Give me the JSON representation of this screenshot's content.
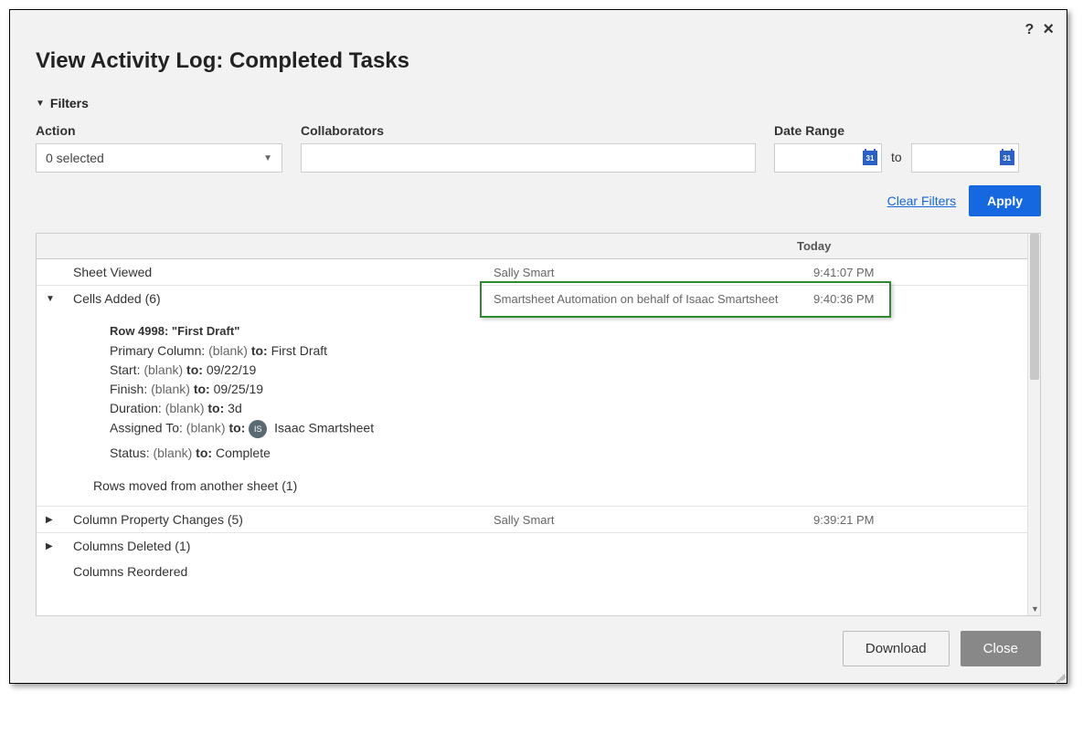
{
  "header": {
    "title": "View Activity Log: Completed Tasks"
  },
  "filters": {
    "section_label": "Filters",
    "action_label": "Action",
    "action_selected": "0 selected",
    "collaborators_label": "Collaborators",
    "date_range_label": "Date Range",
    "to_label": "to",
    "clear_filters": "Clear Filters",
    "apply": "Apply"
  },
  "log": {
    "date_header": "Today",
    "rows": [
      {
        "expanded": null,
        "event": "Sheet Viewed",
        "collab": "Sally Smart",
        "time": "9:41:07 PM"
      },
      {
        "expanded": true,
        "event": "Cells Added (6)",
        "collab": "Smartsheet Automation on behalf of Isaac Smartsheet",
        "time": "9:40:36 PM"
      }
    ],
    "details": {
      "row_title": "Row 4998: \"First Draft\"",
      "changes": [
        {
          "field": "Primary Column:",
          "from": "(blank)",
          "to": "First Draft"
        },
        {
          "field": "Start:",
          "from": "(blank)",
          "to": "09/22/19"
        },
        {
          "field": "Finish:",
          "from": "(blank)",
          "to": "09/25/19"
        },
        {
          "field": "Duration:",
          "from": "(blank)",
          "to": "3d"
        },
        {
          "field": "Assigned To:",
          "from": "(blank)",
          "to_avatar": "IS",
          "to": "Isaac Smartsheet"
        },
        {
          "field": "Status:",
          "from": "(blank)",
          "to": "Complete"
        }
      ],
      "footer": "Rows moved from another sheet (1)",
      "to_word": "to:"
    },
    "rows_after": [
      {
        "expanded": false,
        "event": "Column Property Changes (5)",
        "collab": "Sally Smart",
        "time": "9:39:21 PM"
      },
      {
        "expanded": false,
        "event": "Columns Deleted (1)",
        "collab": "",
        "time": ""
      },
      {
        "expanded": null,
        "event": "Columns Reordered",
        "collab": "",
        "time": ""
      }
    ]
  },
  "footer": {
    "download": "Download",
    "close": "Close"
  },
  "icons": {
    "help": "?",
    "close": "×",
    "cal_text": "31"
  }
}
